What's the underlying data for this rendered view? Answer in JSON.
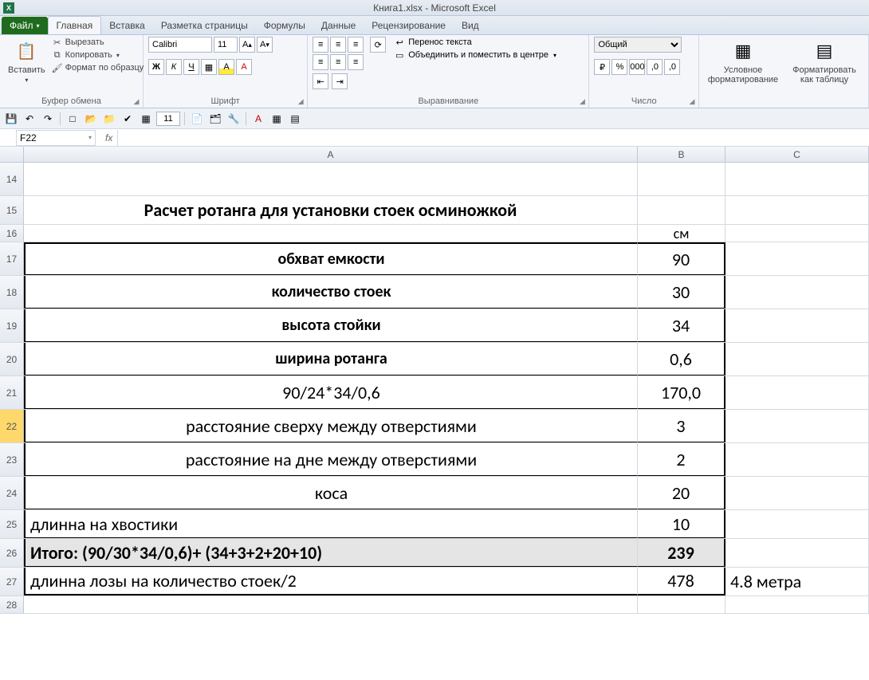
{
  "title": "Книга1.xlsx  -  Microsoft Excel",
  "tabs": {
    "file": "Файл",
    "home": "Главная",
    "insert": "Вставка",
    "layout": "Разметка страницы",
    "formulas": "Формулы",
    "data": "Данные",
    "review": "Рецензирование",
    "view": "Вид"
  },
  "clipboard": {
    "paste": "Вставить",
    "cut": "Вырезать",
    "copy": "Копировать",
    "format_painter": "Формат по образцу",
    "label": "Буфер обмена"
  },
  "font": {
    "name": "Calibri",
    "size": "11",
    "label": "Шрифт"
  },
  "align": {
    "wrap": "Перенос текста",
    "merge": "Объединить и поместить в центре",
    "label": "Выравнивание"
  },
  "number": {
    "format": "Общий",
    "label": "Число"
  },
  "styles": {
    "cond": "Условное форматирование",
    "table": "Форматировать как таблицу"
  },
  "qat_font_size": "11",
  "namebox": "F22",
  "formula": "",
  "cols": {
    "A": "A",
    "B": "B",
    "C": "C"
  },
  "rows": {
    "14": {
      "n": "14"
    },
    "15": {
      "n": "15",
      "A": "Расчет ротанга для установки стоек осминожкой"
    },
    "16": {
      "n": "16",
      "B": "см"
    },
    "17": {
      "n": "17",
      "A": "обхват емкости",
      "B": "90"
    },
    "18": {
      "n": "18",
      "A": "количество стоек",
      "B": "30"
    },
    "19": {
      "n": "19",
      "A": "высота стойки",
      "B": "34"
    },
    "20": {
      "n": "20",
      "A": "ширина ротанга",
      "B": "0,6"
    },
    "21": {
      "n": "21",
      "A": "90/24*34/0,6",
      "B": "170,0"
    },
    "22": {
      "n": "22",
      "A": "расстояние сверху между отверстиями",
      "B": "3"
    },
    "23": {
      "n": "23",
      "A": "расстояние на дне между отверстиями",
      "B": "2"
    },
    "24": {
      "n": "24",
      "A": "коса",
      "B": "20"
    },
    "25": {
      "n": "25",
      "A": "длинна на хвостики",
      "B": "10"
    },
    "26": {
      "n": "26",
      "A": "Итого: (90/30*34/0,6)+ (34+3+2+20+10)",
      "B": "239"
    },
    "27": {
      "n": "27",
      "A": "длинна лозы на  количество стоек/2",
      "B": "478",
      "C": "4.8 метра"
    },
    "28": {
      "n": "28"
    }
  }
}
